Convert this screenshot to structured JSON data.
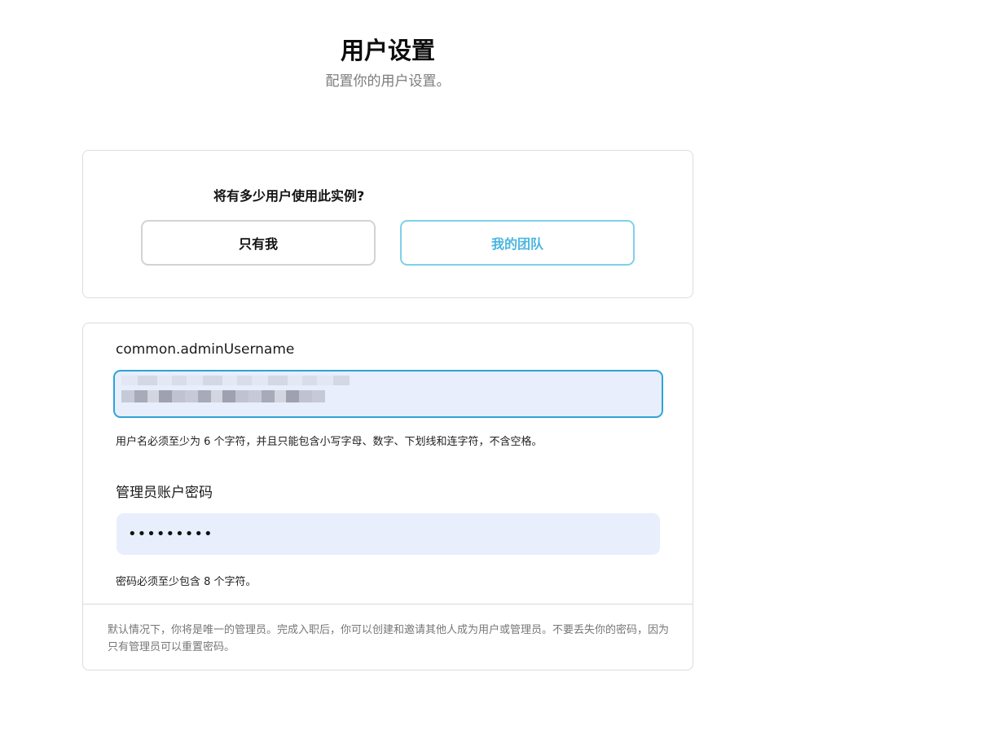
{
  "header": {
    "title": "用户设置",
    "subtitle": "配置你的用户设置。"
  },
  "users_card": {
    "question": "将有多少用户使用此实例?",
    "options": [
      {
        "label": "只有我",
        "selected": false
      },
      {
        "label": "我的团队",
        "selected": true
      }
    ]
  },
  "form": {
    "username": {
      "label": "common.adminUsername",
      "value": "",
      "hint": "用户名必须至少为 6 个字符，并且只能包含小写字母、数字、下划线和连字符，不含空格。"
    },
    "password": {
      "label": "管理员账户密码",
      "masked_value": "•••••••••",
      "hint": "密码必须至少包含 8 个字符。"
    },
    "footnote": "默认情况下，你将是唯一的管理员。完成入职后，你可以创建和邀请其他人成为用户或管理员。不要丢失你的密码，因为只有管理员可以重置密码。"
  },
  "colors": {
    "accent": "#2da3d8",
    "selected_option": "#4bb6e0",
    "input_bg": "#e8eefb"
  }
}
